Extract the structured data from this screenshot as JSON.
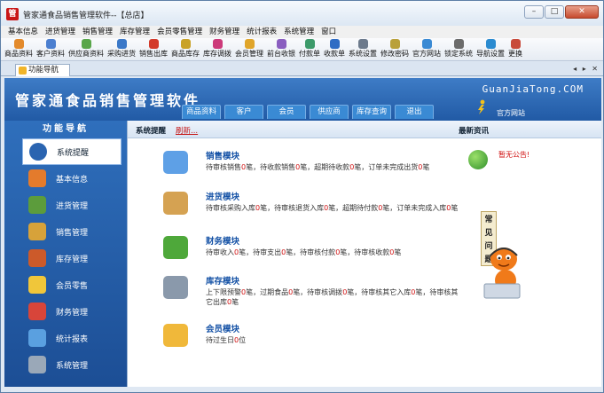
{
  "window": {
    "title": "管家通食品销售管理软件--【总店】",
    "controls": [
      "–",
      "□",
      "✕"
    ]
  },
  "menu": [
    "基本信息",
    "进货管理",
    "销售管理",
    "库存管理",
    "会员零售管理",
    "财务管理",
    "统计报表",
    "系统管理",
    "窗口"
  ],
  "toolbar": [
    {
      "label": "商品资料",
      "color": "#e38a2b"
    },
    {
      "label": "客户资料",
      "color": "#4b7fd0"
    },
    {
      "label": "供应商资料",
      "color": "#59a64a"
    },
    {
      "label": "采购进货",
      "color": "#3a78c8"
    },
    {
      "label": "销售出库",
      "color": "#d33a2a"
    },
    {
      "label": "商品库存",
      "color": "#c9a227"
    },
    {
      "label": "库存调拨",
      "color": "#cc3a7a"
    },
    {
      "label": "会员管理",
      "color": "#e0a52a"
    },
    {
      "label": "前台收银",
      "color": "#8a5ec0"
    },
    {
      "label": "付款单",
      "color": "#3c9a6a"
    },
    {
      "label": "收款单",
      "color": "#2f6cc4"
    },
    {
      "label": "系统设置",
      "color": "#6c7a8c"
    },
    {
      "label": "修改密码",
      "color": "#b9a03a"
    },
    {
      "label": "官方网站",
      "color": "#3a8ad4"
    },
    {
      "label": "锁定系统",
      "color": "#6b6b6b"
    },
    {
      "label": "导航设置",
      "color": "#2b8bd0"
    },
    {
      "label": "更换",
      "color": "#c84a3a"
    }
  ],
  "tab": {
    "label": "功能导航",
    "controls": "◂ ▸ ✕"
  },
  "banner": {
    "title": "管家通食品销售管理软件",
    "domain": "GuanJiaTong.COM",
    "tabs": [
      "商品资料",
      "客户",
      "会员",
      "供应商",
      "库存查询",
      "退出"
    ],
    "site_label": "官方网站"
  },
  "sidebar": {
    "heading": "功能导航",
    "items": [
      {
        "label": "系统提醒",
        "icon": "info-icon",
        "color": "#2a64b0",
        "active": true
      },
      {
        "label": "基本信息",
        "icon": "cubes-icon",
        "color": "#e47b2c"
      },
      {
        "label": "进货管理",
        "icon": "box-in-icon",
        "color": "#5c9c3c"
      },
      {
        "label": "销售管理",
        "icon": "box-out-icon",
        "color": "#d7a23a"
      },
      {
        "label": "库存管理",
        "icon": "warehouse-icon",
        "color": "#cc5a2a"
      },
      {
        "label": "会员零售",
        "icon": "coins-icon",
        "color": "#f0c63a"
      },
      {
        "label": "财务管理",
        "icon": "money-icon",
        "color": "#d8453a"
      },
      {
        "label": "统计报表",
        "icon": "report-icon",
        "color": "#5aa0e0"
      },
      {
        "label": "系统管理",
        "icon": "gears-icon",
        "color": "#9aa8b8"
      }
    ]
  },
  "main": {
    "header_title": "系统提醒",
    "refresh": "刷新...",
    "news_title": "最新资讯",
    "news_link": "暂无公告!",
    "modules": [
      {
        "title": "销售模块",
        "icon": "book-icon",
        "color": "#5ea0e6",
        "detail": [
          {
            "t": "待审核销售"
          },
          {
            "t": "0",
            "r": true
          },
          {
            "t": "笔，待收款销售"
          },
          {
            "t": "0",
            "r": true
          },
          {
            "t": "笔，超期待收款"
          },
          {
            "t": "0",
            "r": true
          },
          {
            "t": "笔，订单未完成出货"
          },
          {
            "t": "0",
            "r": true
          },
          {
            "t": "笔"
          }
        ]
      },
      {
        "title": "进货模块",
        "icon": "box-icon",
        "color": "#d5a252",
        "detail": [
          {
            "t": "待审核采购入库"
          },
          {
            "t": "0",
            "r": true
          },
          {
            "t": "笔，待审核退货入库"
          },
          {
            "t": "0",
            "r": true
          },
          {
            "t": "笔，超期待付款"
          },
          {
            "t": "0",
            "r": true
          },
          {
            "t": "笔，订单未完成入库"
          },
          {
            "t": "0",
            "r": true
          },
          {
            "t": "笔"
          }
        ]
      },
      {
        "title": "财务模块",
        "icon": "money-icon",
        "color": "#4ea83a",
        "detail": [
          {
            "t": "待审收入"
          },
          {
            "t": "0",
            "r": true
          },
          {
            "t": "笔，待审支出"
          },
          {
            "t": "0",
            "r": true
          },
          {
            "t": "笔，待审核付款"
          },
          {
            "t": "0",
            "r": true
          },
          {
            "t": "笔，待审核收款"
          },
          {
            "t": "0",
            "r": true
          },
          {
            "t": "笔"
          }
        ]
      },
      {
        "title": "库存模块",
        "icon": "disk-icon",
        "color": "#8a99ab",
        "detail": [
          {
            "t": "上下限预警"
          },
          {
            "t": "0",
            "r": true
          },
          {
            "t": "笔，过期食品"
          },
          {
            "t": "0",
            "r": true
          },
          {
            "t": "笔，待审核调拨"
          },
          {
            "t": "0",
            "r": true
          },
          {
            "t": "笔，待审核其它入库"
          },
          {
            "t": "0",
            "r": true
          },
          {
            "t": "笔，待审核其它出库"
          },
          {
            "t": "0",
            "r": true
          },
          {
            "t": "笔"
          }
        ]
      },
      {
        "title": "会员模块",
        "icon": "chat-icon",
        "color": "#f0b83a",
        "detail": [
          {
            "t": "待过生日"
          },
          {
            "t": "0",
            "r": true
          },
          {
            "t": "位"
          }
        ]
      }
    ],
    "faq": "常见问题"
  }
}
